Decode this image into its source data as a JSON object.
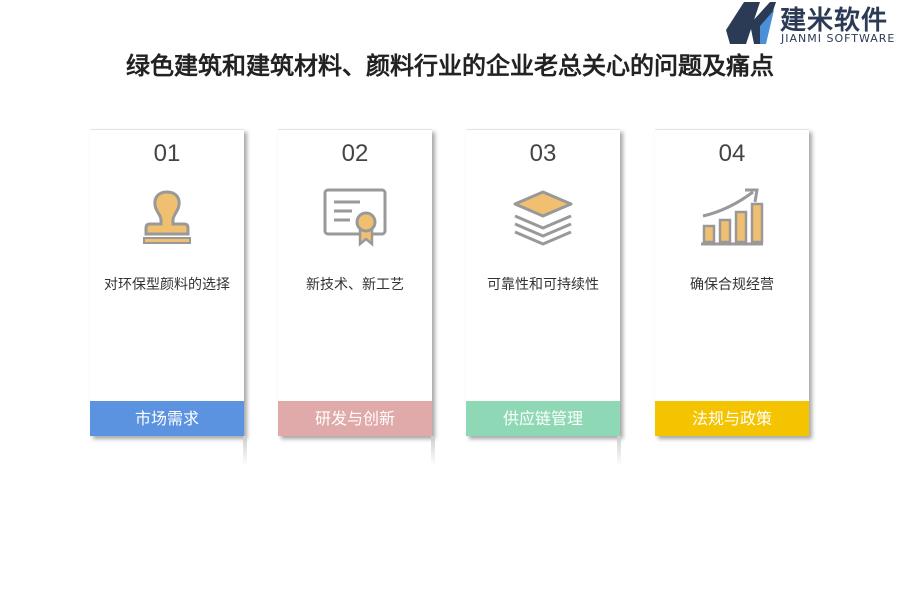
{
  "logo": {
    "name_cn": "建米软件",
    "name_en": "JIANMI SOFTWARE",
    "colors": [
      "#2b3a55",
      "#4a8fd8"
    ]
  },
  "title": "绿色建筑和建筑材料、颜料行业的企业老总关心的问题及痛点",
  "cards": [
    {
      "number": "01",
      "icon": "stamp-icon",
      "description": "对环保型颜料的选择",
      "tag": "市场需求",
      "tag_color": "#5b93e0"
    },
    {
      "number": "02",
      "icon": "certificate-icon",
      "description": "新技术、新工艺",
      "tag": "研发与创新",
      "tag_color": "#e0aaaa"
    },
    {
      "number": "03",
      "icon": "layers-icon",
      "description": "可靠性和可持续性",
      "tag": "供应链管理",
      "tag_color": "#8fd8b5"
    },
    {
      "number": "04",
      "icon": "growth-chart-icon",
      "description": "确保合规经营",
      "tag": "法规与政策",
      "tag_color": "#f5c400"
    }
  ],
  "icon_colors": {
    "fill": "#f0c070",
    "stroke": "#999999"
  }
}
